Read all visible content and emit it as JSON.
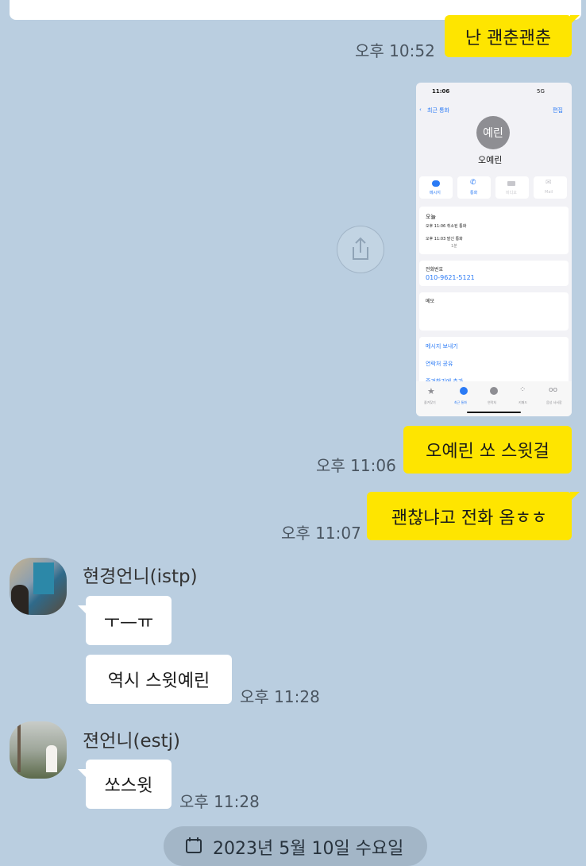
{
  "messages": {
    "m1": {
      "text": "난 괜춘괜춘",
      "time": "오후 10:52"
    },
    "m2": {
      "time": "오후 11:06"
    },
    "m3": {
      "text": "오예린 쏘 스윗걸",
      "time": "오후 11:06"
    },
    "m4": {
      "text": "괜찮냐고 전화 옴ㅎㅎ",
      "time": "오후 11:07"
    },
    "g1": {
      "name": "현경언니(istp)",
      "texts": [
        "ㅜ—ㅠ",
        "역시 스윗예린"
      ],
      "time": "오후 11:28"
    },
    "g2": {
      "name": "젼언니(estj)",
      "text": "쏘스윗",
      "time": "오후 11:28"
    }
  },
  "screenshot": {
    "status_time": "11:06",
    "status_right": "5G",
    "back_label": "최근 통화",
    "edit_label": "편집",
    "avatar_text": "예린",
    "contact_name": "오예린",
    "actions": [
      "메시지",
      "통화",
      "비디오",
      "Mail"
    ],
    "today_label": "오늘",
    "call1": "오후 11:06  취소된 통화",
    "call2": "오후 11:03  발신 통화",
    "call2_sub": "1분",
    "phone_label": "전화번호",
    "phone_number": "010-9621-5121",
    "memo_label": "메모",
    "links": [
      "메시지 보내기",
      "연락처 공유",
      "즐겨찾기에 추가"
    ],
    "tabs": [
      "즐겨찾기",
      "최근 통화",
      "연락처",
      "키패드",
      "음성 사서함"
    ]
  },
  "date_divider": "2023년 5월 10일 수요일",
  "colors": {
    "background": "#bacee0",
    "my_bubble": "#fee500",
    "their_bubble": "#ffffff"
  }
}
